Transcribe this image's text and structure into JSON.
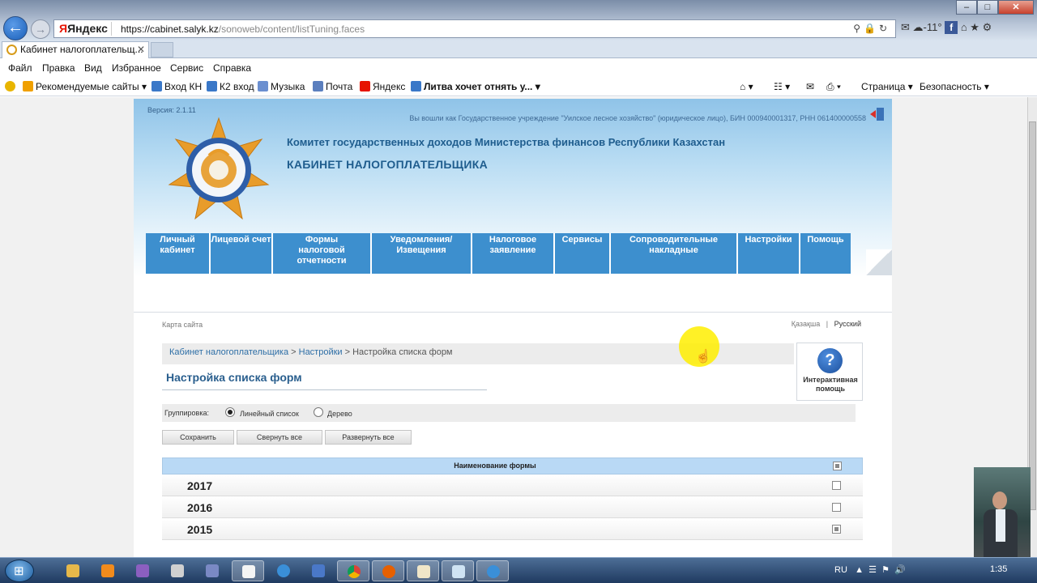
{
  "browser": {
    "url_host": "https://cabinet.salyk.kz",
    "url_path": "/sonoweb/content/listTuning.faces",
    "search_brand": "Яндекс",
    "weather": "-11°",
    "tab_title": "Кабинет налогоплательщ..."
  },
  "menubar": [
    "Файл",
    "Правка",
    "Вид",
    "Избранное",
    "Сервис",
    "Справка"
  ],
  "favorites": {
    "items": [
      "Рекомендуемые сайты ▾",
      "Вход КН",
      "К2 вход",
      "Музыка",
      "Почта",
      "Яндекс",
      "Литва хочет отнять у... ▾"
    ],
    "right": [
      "Страница ▾",
      "Безопасность ▾"
    ]
  },
  "header": {
    "version": "Версия: 2.1.11",
    "user_info": "Вы вошли как Государственное учреждение \"Уилское лесное хозяйство\" (юридическое лицо), БИН 000940001317, РНН 061400000558",
    "org_name": "Комитет государственных доходов Министерства финансов Республики Казахстан",
    "cabinet_title": "КАБИНЕТ НАЛОГОПЛАТЕЛЬЩИКА"
  },
  "nav": [
    "Личный кабинет",
    "Лицевой счет",
    "Формы налоговой отчетности",
    "Уведомления/ Извещения",
    "Налоговое заявление",
    "Сервисы",
    "Сопроводительные накладные",
    "Настройки",
    "Помощь"
  ],
  "sitemap": "Карта сайта",
  "lang": {
    "kz": "Қазақша",
    "sep": "|",
    "ru": "Русский"
  },
  "breadcrumb": {
    "root": "Кабинет налогоплательщика",
    "sep": " > ",
    "section": "Настройки",
    "current": "Настройка списка форм"
  },
  "page_title": "Настройка списка форм",
  "help": {
    "label": "Интерактивная помощь",
    "icon": "?"
  },
  "grouping": {
    "label": "Группировка:",
    "options": [
      "Линейный список",
      "Дерево"
    ],
    "selected": "Линейный список"
  },
  "buttons": {
    "save": "Сохранить",
    "collapse": "Свернуть все",
    "expand": "Развернуть все"
  },
  "table": {
    "header": "Наименование формы",
    "rows": [
      {
        "year": "2017",
        "checked": "unchecked"
      },
      {
        "year": "2016",
        "checked": "unchecked"
      },
      {
        "year": "2015",
        "checked": "partial"
      }
    ]
  },
  "taskbar": {
    "lang": "RU",
    "time": "1:35"
  }
}
